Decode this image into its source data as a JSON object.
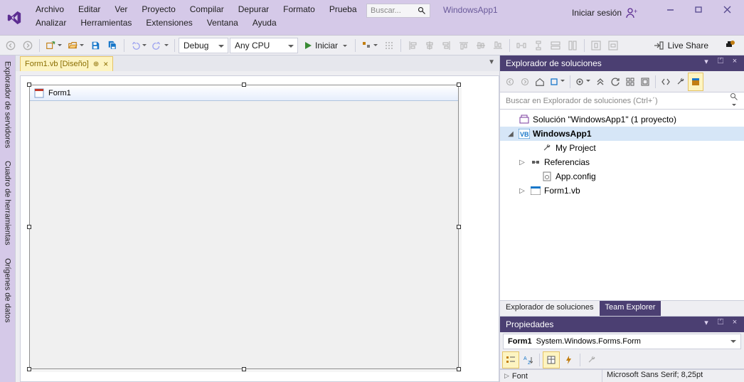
{
  "menu": {
    "row1": [
      "Archivo",
      "Editar",
      "Ver",
      "Proyecto",
      "Compilar",
      "Depurar",
      "Formato",
      "Prueba"
    ],
    "row2": [
      "Analizar",
      "Herramientas",
      "Extensiones",
      "Ventana",
      "Ayuda"
    ]
  },
  "title_search_placeholder": "Buscar...",
  "title_app_name": "WindowsApp1",
  "login_label": "Iniciar sesión",
  "toolbar": {
    "config_label": "Debug",
    "platform_label": "Any CPU",
    "start_label": "Iniciar",
    "liveshare_label": "Live Share"
  },
  "left_rail_tabs": [
    "Explorador de servidores",
    "Cuadro de herramientas",
    "Orígenes de datos"
  ],
  "doc_tab_label": "Form1.vb [Diseño]",
  "form_title": "Form1",
  "solution_explorer": {
    "title": "Explorador de soluciones",
    "search_placeholder": "Buscar en Explorador de soluciones (Ctrl+´)",
    "solution_text_pre": "Solución \"WindowsApp1\" ",
    "solution_text_post": " (1 proyecto)",
    "project": "WindowsApp1",
    "items": {
      "my_project": "My Project",
      "references": "Referencias",
      "appconfig": "App.config",
      "form1": "Form1.vb"
    },
    "bottom_tabs": {
      "se": "Explorador de soluciones",
      "team": "Team Explorer"
    }
  },
  "properties": {
    "title": "Propiedades",
    "object_name": "Form1",
    "object_type": "System.Windows.Forms.Form",
    "row_label": "Font",
    "row_value": "Microsoft Sans Serif; 8,25pt"
  }
}
